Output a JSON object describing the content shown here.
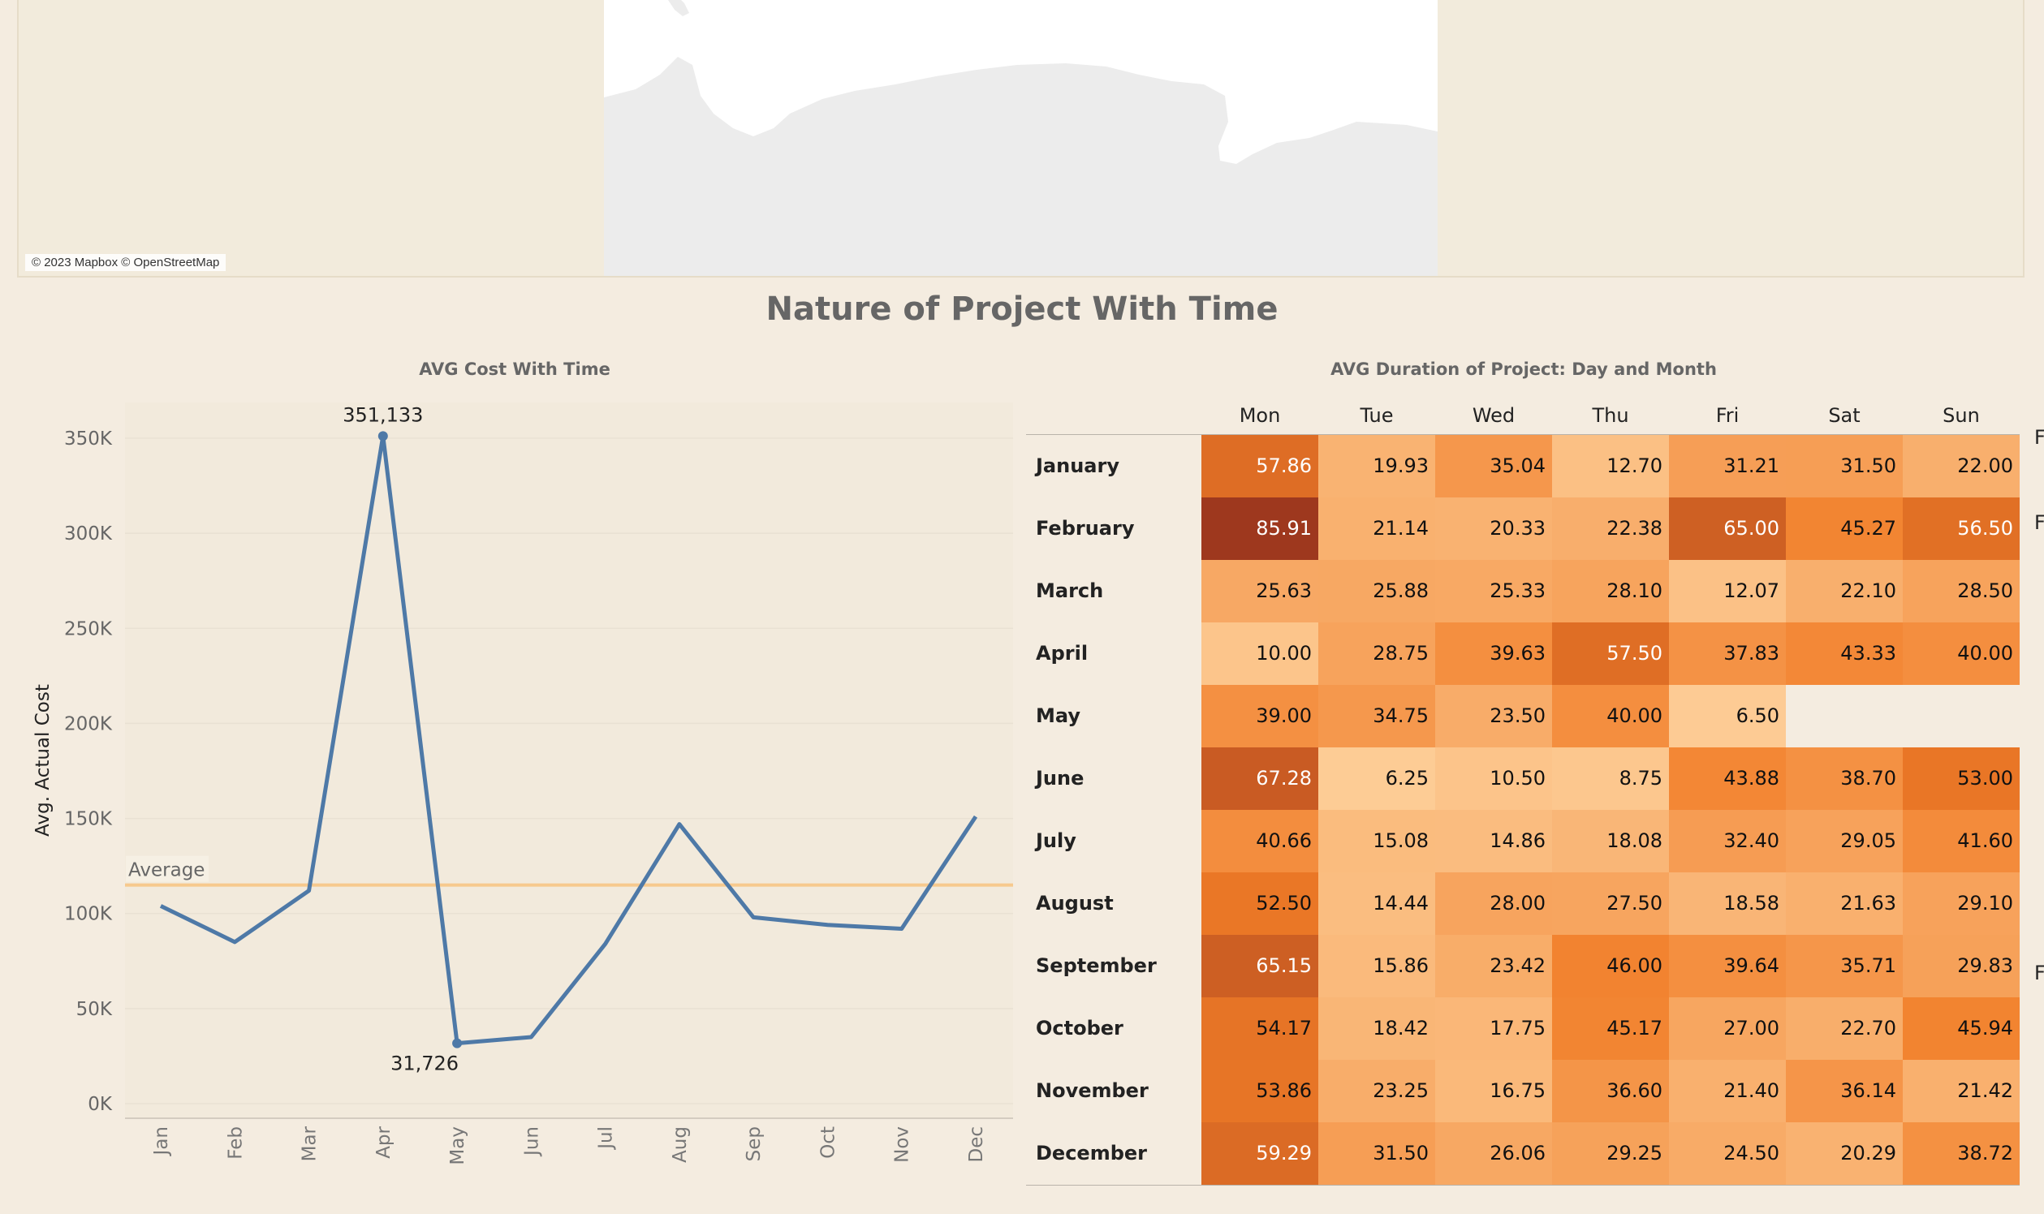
{
  "map": {
    "credit": "© 2023 Mapbox © OpenStreetMap"
  },
  "dashboard_title": "Nature of Project With Time",
  "chart_data": [
    {
      "type": "line",
      "title": "AVG Cost With Time",
      "xlabel": "",
      "ylabel": "Avg. Actual Cost",
      "categories": [
        "Jan",
        "Feb",
        "Mar",
        "Apr",
        "May",
        "Jun",
        "Jul",
        "Aug",
        "Sep",
        "Oct",
        "Nov",
        "Dec"
      ],
      "values": [
        104000,
        85000,
        112000,
        351133,
        31726,
        35000,
        84000,
        147000,
        98000,
        94000,
        92000,
        151000
      ],
      "ylim": [
        0,
        370000
      ],
      "yticks": [
        0,
        50000,
        100000,
        150000,
        200000,
        250000,
        300000,
        350000
      ],
      "ytick_labels": [
        "0K",
        "50K",
        "100K",
        "150K",
        "200K",
        "250K",
        "300K",
        "350K"
      ],
      "reference_line": {
        "label": "Average",
        "value": 115000,
        "color": "#f7c98d"
      },
      "data_labels": [
        {
          "index": 3,
          "text": "351,133"
        },
        {
          "index": 4,
          "text": "31,726"
        }
      ],
      "line_color": "#4e79a7",
      "grid": true
    },
    {
      "type": "heatmap",
      "title": "AVG Duration of Project: Day and Month",
      "columns": [
        "Mon",
        "Tue",
        "Wed",
        "Thu",
        "Fri",
        "Sat",
        "Sun"
      ],
      "rows": [
        "January",
        "February",
        "March",
        "April",
        "May",
        "June",
        "July",
        "August",
        "September",
        "October",
        "November",
        "December"
      ],
      "values": [
        [
          57.86,
          19.93,
          35.04,
          12.7,
          31.21,
          31.5,
          22.0
        ],
        [
          85.91,
          21.14,
          20.33,
          22.38,
          65.0,
          45.27,
          56.5
        ],
        [
          25.63,
          25.88,
          25.33,
          28.1,
          12.07,
          22.1,
          28.5
        ],
        [
          10.0,
          28.75,
          39.63,
          57.5,
          37.83,
          43.33,
          40.0
        ],
        [
          39.0,
          34.75,
          23.5,
          40.0,
          6.5,
          null,
          null
        ],
        [
          67.28,
          6.25,
          10.5,
          8.75,
          43.88,
          38.7,
          53.0
        ],
        [
          40.66,
          15.08,
          14.86,
          18.08,
          32.4,
          29.05,
          41.6
        ],
        [
          52.5,
          14.44,
          28.0,
          27.5,
          18.58,
          21.63,
          29.1
        ],
        [
          65.15,
          15.86,
          23.42,
          46.0,
          39.64,
          35.71,
          29.83
        ],
        [
          54.17,
          18.42,
          17.75,
          45.17,
          27.0,
          22.7,
          45.94
        ],
        [
          53.86,
          23.25,
          16.75,
          36.6,
          21.4,
          36.14,
          21.42
        ],
        [
          59.29,
          31.5,
          26.06,
          29.25,
          24.5,
          20.29,
          38.72
        ]
      ],
      "color_scale": "orange sequential"
    }
  ],
  "edge_labels": [
    "F",
    "F",
    "F"
  ]
}
